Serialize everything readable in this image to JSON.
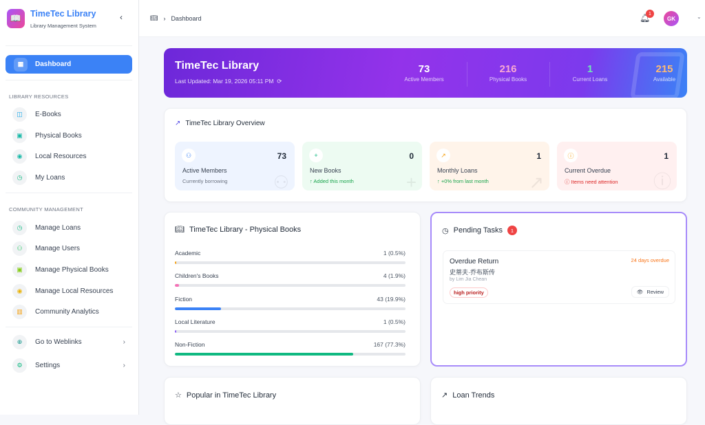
{
  "sidebar": {
    "brand": "TimeTec Library",
    "subtitle": "Library Management System",
    "active": "Dashboard",
    "section1": "LIBRARY RESOURCES",
    "section2": "COMMUNITY MANAGEMENT",
    "items": [
      "E-Books",
      "Physical Books",
      "Local Resources",
      "My Loans",
      "Manage Loans",
      "Manage Users",
      "Manage Physical Books",
      "Manage Local Resources",
      "Community Analytics",
      "Go to Weblinks",
      "Settings"
    ]
  },
  "topbar": {
    "breadcrumb": "Dashboard",
    "notifications": "1",
    "avatar": "GK"
  },
  "hero": {
    "title": "TimeTec Library",
    "updated": "Last Updated: Mar 19, 2026 05:11 PM",
    "stats": [
      {
        "value": "73",
        "label": "Active Members"
      },
      {
        "value": "216",
        "label": "Physical Books"
      },
      {
        "value": "1",
        "label": "Current Loans"
      },
      {
        "value": "215",
        "label": "Available"
      }
    ]
  },
  "overview": {
    "title": "TimeTec Library Overview",
    "cards": [
      {
        "title": "Active Members",
        "value": "73",
        "sub": "Currently borrowing"
      },
      {
        "title": "New Books",
        "value": "0",
        "sub": "↑ Added this month"
      },
      {
        "title": "Monthly Loans",
        "value": "1",
        "sub": "↑ +0% from last month"
      },
      {
        "title": "Current Overdue",
        "value": "1",
        "sub": "ⓘ Items need attention"
      }
    ]
  },
  "books": {
    "title": "TimeTec Library - Physical Books",
    "rows": [
      {
        "label": "Academic",
        "count": "1 (0.5%)",
        "percent": 0.5,
        "color": "#f59e0b"
      },
      {
        "label": "Children's Books",
        "count": "4 (1.9%)",
        "percent": 1.9,
        "color": "#f472b6"
      },
      {
        "label": "Fiction",
        "count": "43 (19.9%)",
        "percent": 19.9,
        "color": "#3b82f6"
      },
      {
        "label": "Local Literature",
        "count": "1 (0.5%)",
        "percent": 0.5,
        "color": "#8b5cf6"
      },
      {
        "label": "Non-Fiction",
        "count": "167 (77.3%)",
        "percent": 77.3,
        "color": "#10b981"
      }
    ]
  },
  "pending": {
    "title": "Pending Tasks",
    "count": "1",
    "task": {
      "type": "Overdue Return",
      "book": "史蒂夫·乔布斯传",
      "by": "by Lim Jia Chean",
      "overdue": "24 days overdue",
      "priority": "high priority",
      "action": "Review"
    }
  },
  "popular": {
    "title": "Popular in TimeTec Library"
  },
  "trends": {
    "title": "Loan Trends"
  }
}
